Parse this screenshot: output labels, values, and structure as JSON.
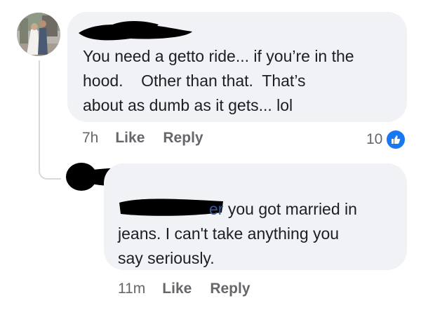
{
  "comment1": {
    "text": "You need a getto ride... if you’re in the\nhood.    Other than that.  That’s\nabout as dumb as it gets... lol",
    "time": "7h",
    "like_label": "Like",
    "reply_label": "Reply",
    "reaction_count": "10"
  },
  "comment2": {
    "mention_suffix": "er",
    "text": " you got married in\njeans. I can't take anything you\nsay seriously.",
    "time": "11m",
    "like_label": "Like",
    "reply_label": "Reply"
  },
  "colors": {
    "bubble": "#f0f2f5",
    "meta_text": "#65676b",
    "mention": "#385898",
    "like_blue": "#1877f2"
  }
}
